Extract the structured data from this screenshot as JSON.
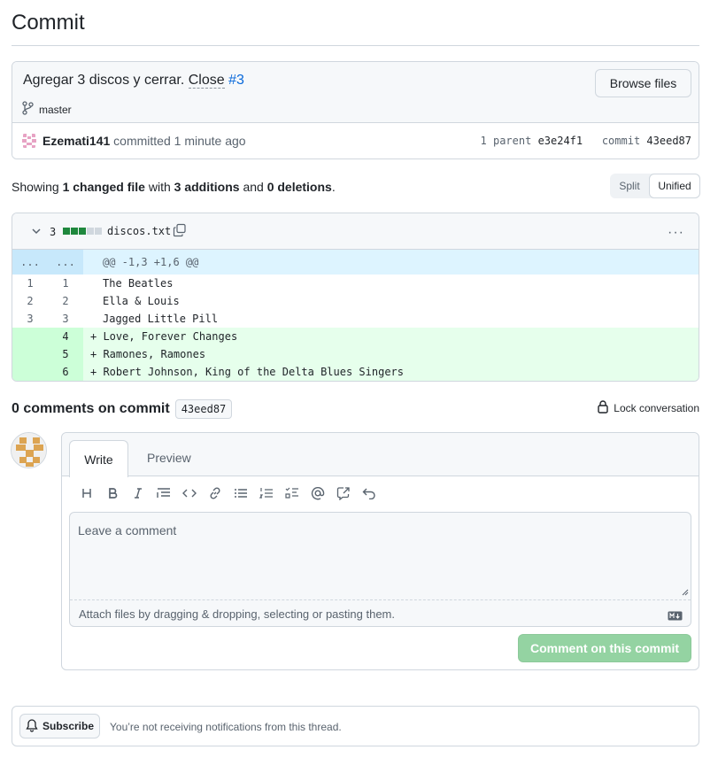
{
  "page": {
    "title": "Commit"
  },
  "commit": {
    "message": "Agregar 3 discos y cerrar.",
    "close_word": "Close",
    "issue_ref": "#3",
    "branch": "master",
    "browse_label": "Browse files",
    "author": "Ezemati141",
    "action": "committed",
    "time": "1 minute ago",
    "parent_label": "1 parent",
    "parent_sha": "e3e24f1",
    "commit_label": "commit",
    "sha": "43eed87"
  },
  "stats": {
    "showing": "Showing",
    "changed": "1 changed file",
    "with": "with",
    "additions": "3 additions",
    "and": "and",
    "deletions": "0 deletions",
    "split_label": "Split",
    "unified_label": "Unified"
  },
  "diff": {
    "count": "3",
    "filename": "discos.txt",
    "add_color": "#1f883d",
    "neutral_color": "#d0d7de",
    "hunk": {
      "n1": "...",
      "n2": "...",
      "text": "@@ -1,3 +1,6 @@"
    },
    "lines": [
      {
        "n1": "1",
        "n2": "1",
        "text": "The Beatles",
        "type": "ctx"
      },
      {
        "n1": "2",
        "n2": "2",
        "text": "Ella & Louis",
        "type": "ctx"
      },
      {
        "n1": "3",
        "n2": "3",
        "text": "Jagged Little Pill",
        "type": "ctx"
      },
      {
        "n1": "",
        "n2": "4",
        "text": "+ Love, Forever Changes",
        "type": "add"
      },
      {
        "n1": "",
        "n2": "5",
        "text": "+ Ramones, Ramones",
        "type": "add"
      },
      {
        "n1": "",
        "n2": "6",
        "text": "+ Robert Johnson, King of the Delta Blues Singers",
        "type": "add"
      }
    ]
  },
  "comments": {
    "heading": "0 comments on commit",
    "sha": "43eed87",
    "lock_label": "Lock conversation"
  },
  "editor": {
    "tab_write": "Write",
    "tab_preview": "Preview",
    "placeholder": "Leave a comment",
    "attach_hint": "Attach files by dragging & dropping, selecting or pasting them.",
    "submit_label": "Comment on this commit",
    "tools": [
      "heading-icon",
      "bold-icon",
      "italic-icon",
      "quote-icon",
      "code-icon",
      "link-icon",
      "unordered-list-icon",
      "ordered-list-icon",
      "task-list-icon",
      "mention-icon",
      "reference-icon",
      "undo-icon"
    ]
  },
  "subscribe": {
    "button_label": "Subscribe",
    "text": "You’re not receiving notifications from this thread."
  }
}
